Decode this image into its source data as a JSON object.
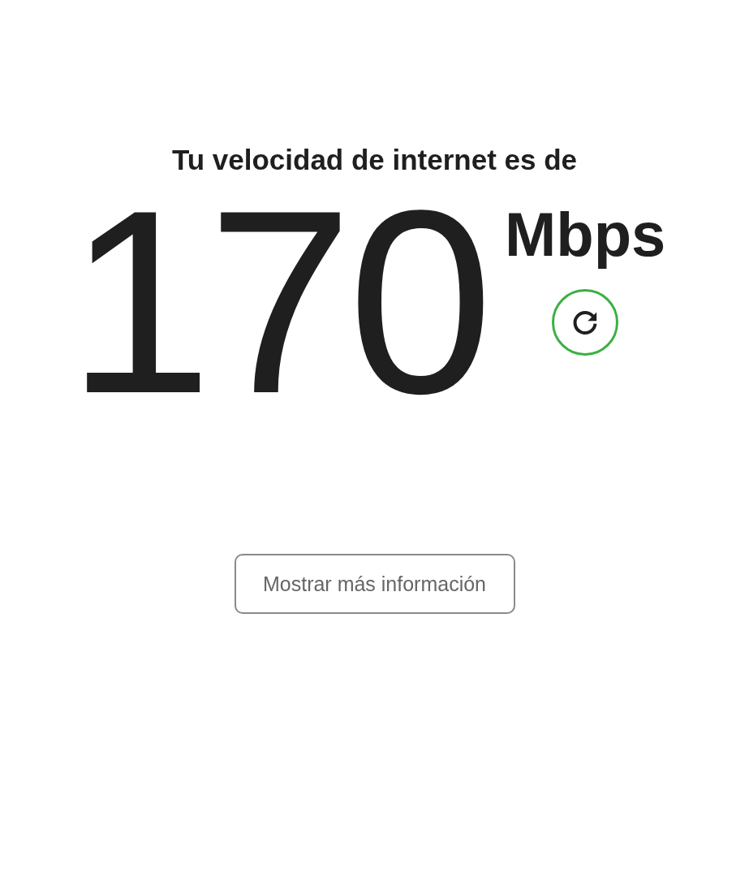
{
  "heading": "Tu velocidad de internet es de",
  "speed": {
    "value": "170",
    "unit": "Mbps"
  },
  "refresh_button": {
    "kind": "icon"
  },
  "more_info_button": {
    "label": "Mostrar más información"
  }
}
